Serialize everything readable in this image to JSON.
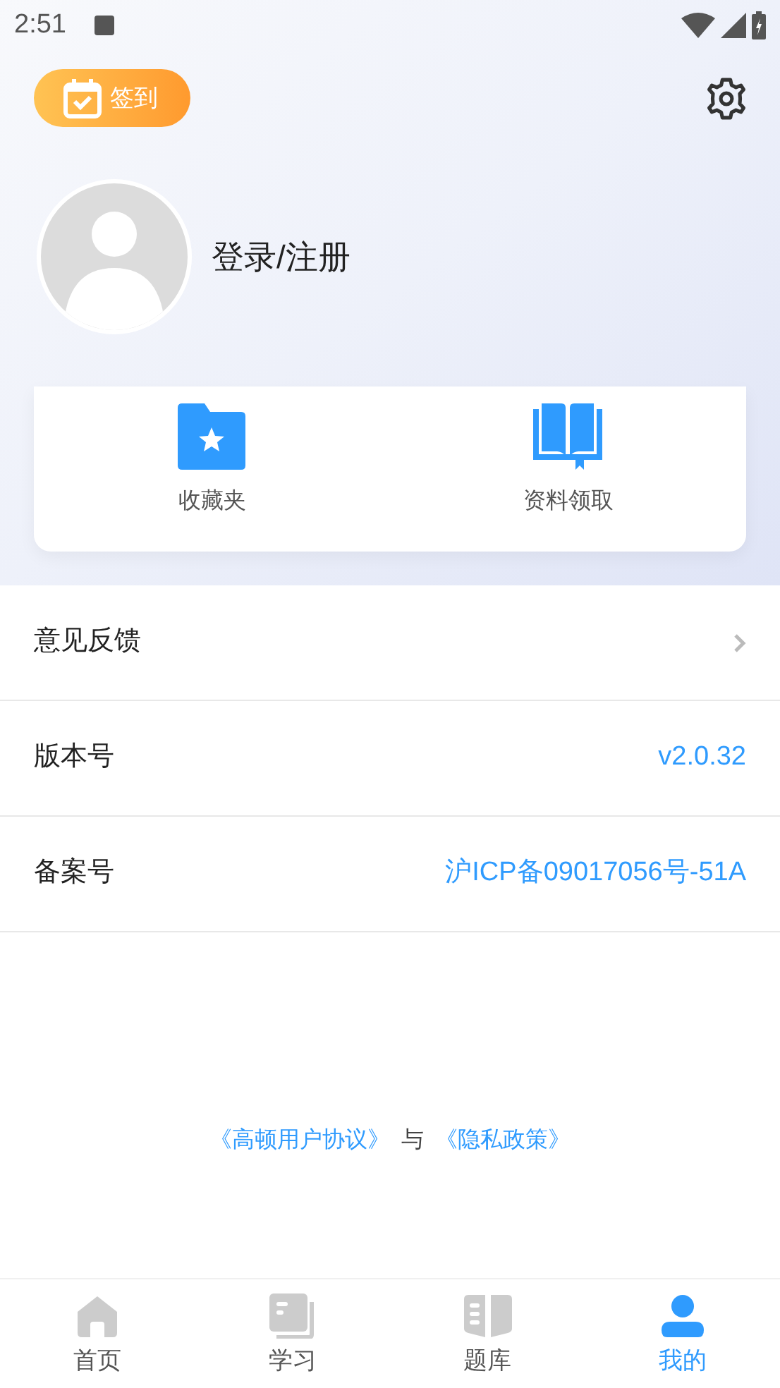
{
  "status_bar": {
    "time": "2:51"
  },
  "header": {
    "checkin_label": "签到"
  },
  "profile": {
    "login_label": "登录/注册"
  },
  "shortcuts": [
    {
      "kind": "favorites",
      "label": "收藏夹"
    },
    {
      "kind": "materials",
      "label": "资料领取"
    }
  ],
  "rows": [
    {
      "kind": "link",
      "label": "意见反馈"
    },
    {
      "kind": "value",
      "label": "版本号",
      "value": "v2.0.32"
    },
    {
      "kind": "value",
      "label": "备案号",
      "value": "沪ICP备09017056号-51A"
    }
  ],
  "footer": {
    "agreement_link": "《高顿用户协议》",
    "separator": "与",
    "privacy_link": "《隐私政策》"
  },
  "tabs": [
    {
      "kind": "home",
      "label": "首页",
      "selected": false
    },
    {
      "kind": "study",
      "label": "学习",
      "selected": false
    },
    {
      "kind": "bank",
      "label": "题库",
      "selected": false
    },
    {
      "kind": "me",
      "label": "我的",
      "selected": true
    }
  ]
}
